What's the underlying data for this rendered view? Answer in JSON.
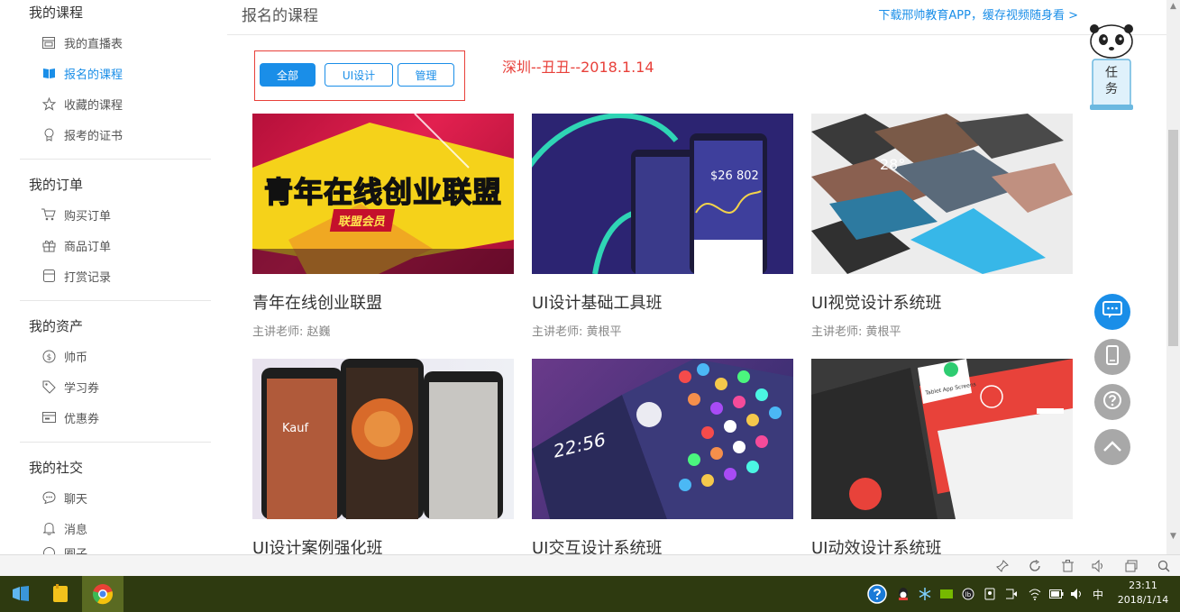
{
  "sidebar": {
    "groups": [
      {
        "title": "我的课程",
        "items": [
          {
            "label": "我的直播表",
            "icon": "calendar-icon"
          },
          {
            "label": "报名的课程",
            "icon": "book-icon",
            "active": true
          },
          {
            "label": "收藏的课程",
            "icon": "star-icon"
          },
          {
            "label": "报考的证书",
            "icon": "certificate-icon"
          }
        ]
      },
      {
        "title": "我的订单",
        "items": [
          {
            "label": "购买订单",
            "icon": "cart-icon"
          },
          {
            "label": "商品订单",
            "icon": "gift-icon"
          },
          {
            "label": "打赏记录",
            "icon": "box-icon"
          }
        ]
      },
      {
        "title": "我的资产",
        "items": [
          {
            "label": "帅币",
            "icon": "dollar-icon"
          },
          {
            "label": "学习券",
            "icon": "tag-icon"
          },
          {
            "label": "优惠券",
            "icon": "coupon-icon"
          }
        ]
      },
      {
        "title": "我的社交",
        "items": [
          {
            "label": "聊天",
            "icon": "chat-icon"
          },
          {
            "label": "消息",
            "icon": "bell-icon"
          },
          {
            "label": "圈子",
            "icon": "circle-icon"
          }
        ]
      }
    ]
  },
  "main": {
    "title": "报名的课程",
    "app_link": "下载邢帅教育APP，缓存视频随身看 >",
    "filters": [
      "全部",
      "UI设计",
      "管理"
    ],
    "annotation": "深圳--丑丑--2018.1.14"
  },
  "courses": [
    {
      "title": "青年在线创业联盟",
      "teacher": "主讲老师: 赵巍",
      "banner": "青年在线创业联盟",
      "badge": "联盟会员"
    },
    {
      "title": "UI设计基础工具班",
      "teacher": "主讲老师: 黄根平",
      "amount": "$26 802"
    },
    {
      "title": "UI视觉设计系统班",
      "teacher": "主讲老师: 黄根平",
      "temp": "28°"
    },
    {
      "title": "UI设计案例强化班",
      "teacher": "",
      "app_name": "Kauf"
    },
    {
      "title": "UI交互设计系统班",
      "teacher": "",
      "time": "22:56"
    },
    {
      "title": "UI动效设计系统班",
      "teacher": "",
      "tag": "Tablet App Screens"
    }
  ],
  "mascot_label": "任务",
  "taskbar": {
    "time": "23:11",
    "date": "2018/1/14",
    "ime": "中"
  },
  "colors": {
    "accent": "#1a8ee8",
    "annotation": "#e8403a",
    "taskbar": "#2e3a10"
  }
}
